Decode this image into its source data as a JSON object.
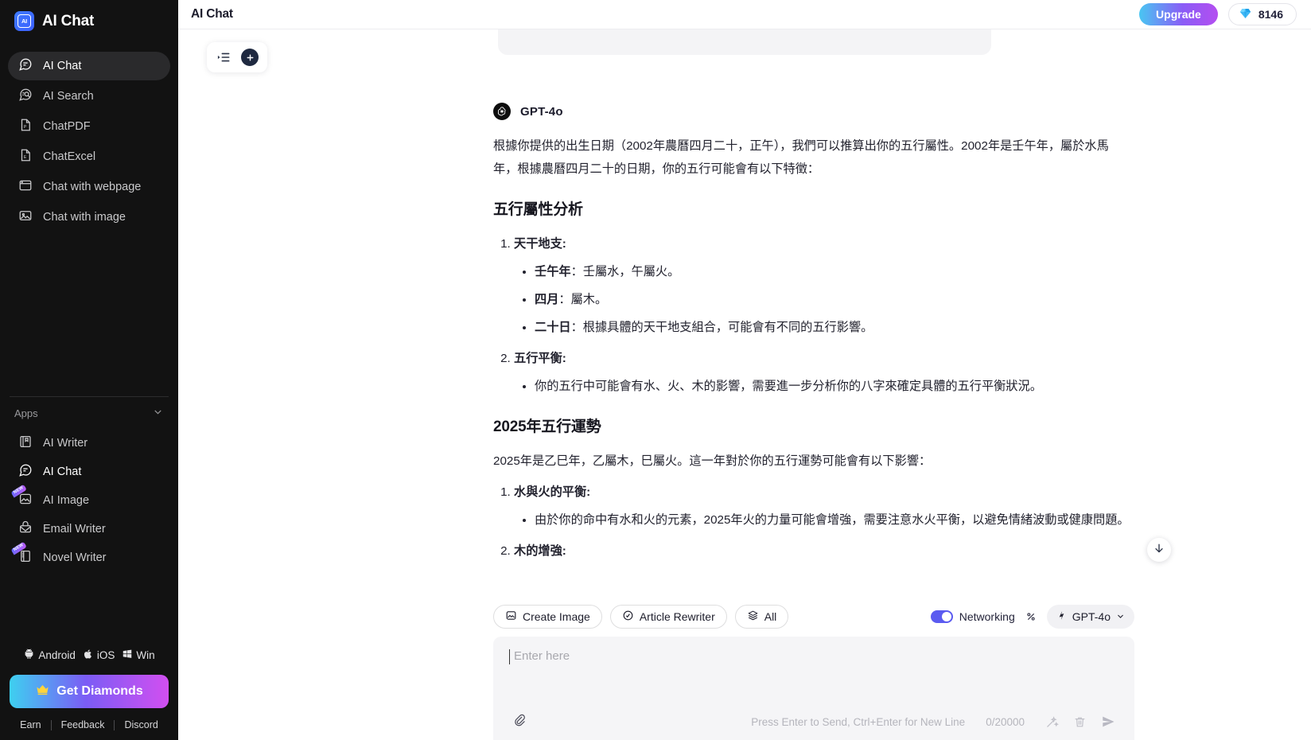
{
  "sidebar": {
    "brand": {
      "name": "AI Chat",
      "logo_text": "AI"
    },
    "nav": [
      {
        "label": "AI Chat",
        "icon": "chat-bubble-icon",
        "active": true
      },
      {
        "label": "AI Search",
        "icon": "search-doc-icon",
        "active": false
      },
      {
        "label": "ChatPDF",
        "icon": "pdf-file-icon",
        "active": false
      },
      {
        "label": "ChatExcel",
        "icon": "excel-file-icon",
        "active": false
      },
      {
        "label": "Chat with webpage",
        "icon": "browser-window-icon",
        "active": false
      },
      {
        "label": "Chat with image",
        "icon": "image-icon",
        "active": false
      }
    ],
    "apps_section": {
      "title": "Apps",
      "chevron": "chevron-down-icon"
    },
    "apps": [
      {
        "label": "AI Writer",
        "icon": "notebook-icon",
        "badge": ""
      },
      {
        "label": "AI Chat",
        "icon": "chat-bubble-icon",
        "badge": ""
      },
      {
        "label": "AI Image",
        "icon": "picture-icon",
        "badge": "NEW"
      },
      {
        "label": "Email Writer",
        "icon": "envelope-icon",
        "badge": ""
      },
      {
        "label": "Novel Writer",
        "icon": "book-icon",
        "badge": "NEW"
      }
    ],
    "platforms": [
      {
        "label": "Android",
        "icon": "android-icon"
      },
      {
        "label": "iOS",
        "icon": "apple-icon"
      },
      {
        "label": "Win",
        "icon": "windows-icon"
      }
    ],
    "get_diamonds": {
      "label": "Get Diamonds",
      "icon": "crown-icon"
    },
    "links": [
      "Earn",
      "Feedback",
      "Discord"
    ]
  },
  "topbar": {
    "title": "AI Chat",
    "upgrade_label": "Upgrade",
    "diamond_count": "8146",
    "diamond_icon": "diamond-icon"
  },
  "float_tools": {
    "history_icon": "list-history-icon",
    "new_chat_icon": "plus-icon"
  },
  "message": {
    "model_name": "GPT-4o",
    "avatar_icon": "openai-logo-icon",
    "paragraph1": "根據你提供的出生日期（2002年農曆四月二十，正午），我們可以推算出你的五行屬性。2002年是壬午年，屬於水馬年，根據農曆四月二十的日期，你的五行可能會有以下特徵：",
    "heading1": "五行屬性分析",
    "section1": [
      {
        "title": "天干地支:",
        "bullets": [
          {
            "bold": "壬午年",
            "rest": "：壬屬水，午屬火。"
          },
          {
            "bold": "四月",
            "rest": "：屬木。"
          },
          {
            "bold": "二十日",
            "rest": "：根據具體的天干地支組合，可能會有不同的五行影響。"
          }
        ]
      },
      {
        "title": "五行平衡:",
        "bullets": [
          {
            "bold": "",
            "rest": "你的五行中可能會有水、火、木的影響，需要進一步分析你的八字來確定具體的五行平衡狀況。"
          }
        ]
      }
    ],
    "heading2": "2025年五行運勢",
    "paragraph2": "2025年是乙巳年，乙屬木，巳屬火。這一年對於你的五行運勢可能會有以下影響：",
    "section2": [
      {
        "title": "水與火的平衡:",
        "bullets": [
          {
            "bold": "",
            "rest": "由於你的命中有水和火的元素，2025年火的力量可能會增強，需要注意水火平衡，以避免情緒波動或健康問題。"
          }
        ]
      },
      {
        "title": "木的增強:",
        "bullets": []
      }
    ]
  },
  "scroll_down_icon": "arrow-down-icon",
  "composer": {
    "chips": [
      {
        "label": "Create Image",
        "icon": "image-create-icon"
      },
      {
        "label": "Article Rewriter",
        "icon": "rewrite-icon"
      },
      {
        "label": "All",
        "icon": "layers-icon"
      }
    ],
    "networking": {
      "label": "Networking",
      "enabled": true
    },
    "percent_icon": "percent-icon",
    "model": {
      "label": "GPT-4o",
      "icon": "spark-icon",
      "chevron": "chevron-down-icon"
    },
    "input_placeholder": "Enter here",
    "input_value": "",
    "hint": "Press Enter to Send, Ctrl+Enter for New Line",
    "counter": "0/20000",
    "attach_icon": "paperclip-icon",
    "bottom_icons": [
      "magic-wand-icon",
      "trash-icon",
      "send-icon"
    ]
  }
}
